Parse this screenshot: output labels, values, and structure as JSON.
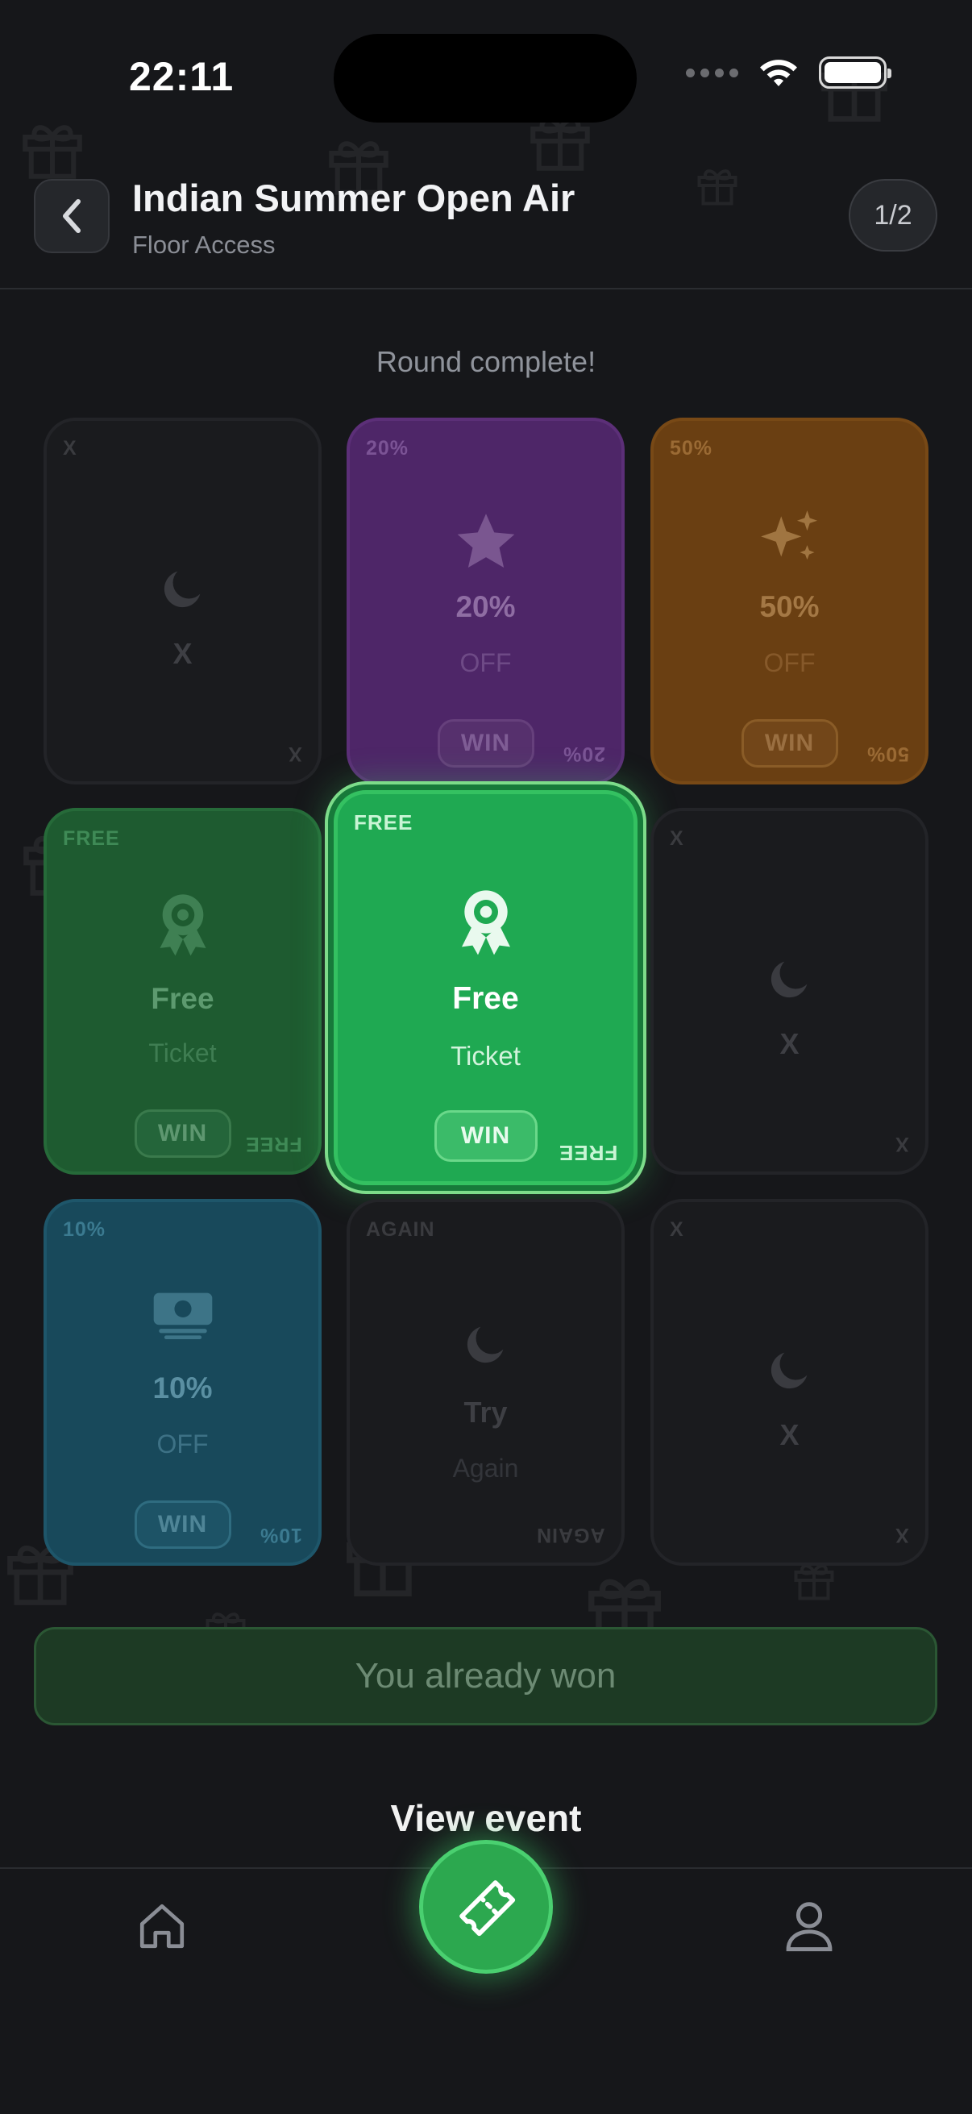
{
  "status_bar": {
    "time": "22:11"
  },
  "header": {
    "title": "Indian Summer Open Air",
    "subtitle": "Floor Access",
    "page_indicator": "1/2"
  },
  "round_status": "Round complete!",
  "cards": [
    {
      "corner": "X",
      "main": "X",
      "sub": "",
      "win": "",
      "icon": "moon-icon",
      "state": "empty"
    },
    {
      "corner": "20%",
      "main": "20%",
      "sub": "OFF",
      "win": "WIN",
      "icon": "star-icon",
      "state": "revealed"
    },
    {
      "corner": "50%",
      "main": "50%",
      "sub": "OFF",
      "win": "WIN",
      "icon": "sparkles-icon",
      "state": "revealed"
    },
    {
      "corner": "FREE",
      "main": "Free",
      "sub": "Ticket",
      "win": "WIN",
      "icon": "award-ribbon-icon",
      "state": "revealed"
    },
    {
      "corner": "FREE",
      "main": "Free",
      "sub": "Ticket",
      "win": "WIN",
      "icon": "award-ribbon-icon",
      "state": "selected-winner"
    },
    {
      "corner": "X",
      "main": "X",
      "sub": "",
      "win": "",
      "icon": "moon-icon",
      "state": "empty"
    },
    {
      "corner": "10%",
      "main": "10%",
      "sub": "OFF",
      "win": "WIN",
      "icon": "cash-icon",
      "state": "revealed"
    },
    {
      "corner": "AGAIN",
      "main": "Try",
      "sub": "Again",
      "win": "",
      "icon": "moon-icon",
      "state": "empty"
    },
    {
      "corner": "X",
      "main": "X",
      "sub": "",
      "win": "",
      "icon": "moon-icon",
      "state": "empty"
    }
  ],
  "actions": {
    "won_label": "You already won",
    "view_event_label": "View event"
  },
  "colors": {
    "accent_green": "#1fa952",
    "purple": "#4e2668",
    "orange": "#6a3f12",
    "blue": "#18495b",
    "background": "#16171a"
  }
}
